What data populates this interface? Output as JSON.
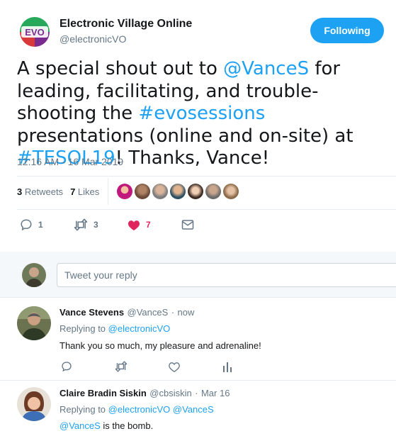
{
  "author": {
    "name": "Electronic Village Online",
    "handle": "@electronicVO",
    "logo_text": "EVO"
  },
  "follow_button": "Following",
  "tweet": {
    "parts": [
      {
        "text": "A special shout out to ",
        "link": false
      },
      {
        "text": "@VanceS",
        "link": true
      },
      {
        "text": " for leading, facilitating, and trouble-shooting the ",
        "link": false
      },
      {
        "text": "#evosessions",
        "link": true
      },
      {
        "text": " presentations (online and on-site) at ",
        "link": false
      },
      {
        "text": "#TESOL19",
        "link": true
      },
      {
        "text": "! Thanks, Vance!",
        "link": false
      }
    ],
    "timestamp": "12:16 AM - 16 Mar 2019"
  },
  "stats": {
    "retweets_count": "3",
    "retweets_label": "Retweets",
    "likes_count": "7",
    "likes_label": "Likes"
  },
  "actions": {
    "reply_count": "1",
    "retweet_count": "3",
    "like_count": "7"
  },
  "reply_box": {
    "placeholder": "Tweet your reply"
  },
  "replies": [
    {
      "name": "Vance Stevens",
      "handle": "@VanceS",
      "time": "now",
      "replying_label": "Replying to",
      "replying_to": [
        "@electronicVO"
      ],
      "body": [
        {
          "text": "Thank you so much, my pleasure and adrenaline!",
          "link": false
        }
      ]
    },
    {
      "name": "Claire Bradin Siskin",
      "handle": "@cbsiskin",
      "time": "Mar 16",
      "replying_label": "Replying to",
      "replying_to": [
        "@electronicVO",
        "@VanceS"
      ],
      "body": [
        {
          "text": "@VanceS",
          "link": true
        },
        {
          "text": " is the bomb.",
          "link": false
        }
      ]
    }
  ],
  "colors": {
    "accent": "#1da1f2",
    "like": "#e0245e",
    "muted": "#657786",
    "text": "#14171a",
    "logo_green": "#27a85a",
    "logo_red": "#d83a3a",
    "logo_purple": "#7a2b8f"
  },
  "icons": {
    "reply": "reply-icon",
    "retweet": "retweet-icon",
    "like": "heart-icon",
    "dm": "envelope-icon",
    "stats": "analytics-icon"
  }
}
